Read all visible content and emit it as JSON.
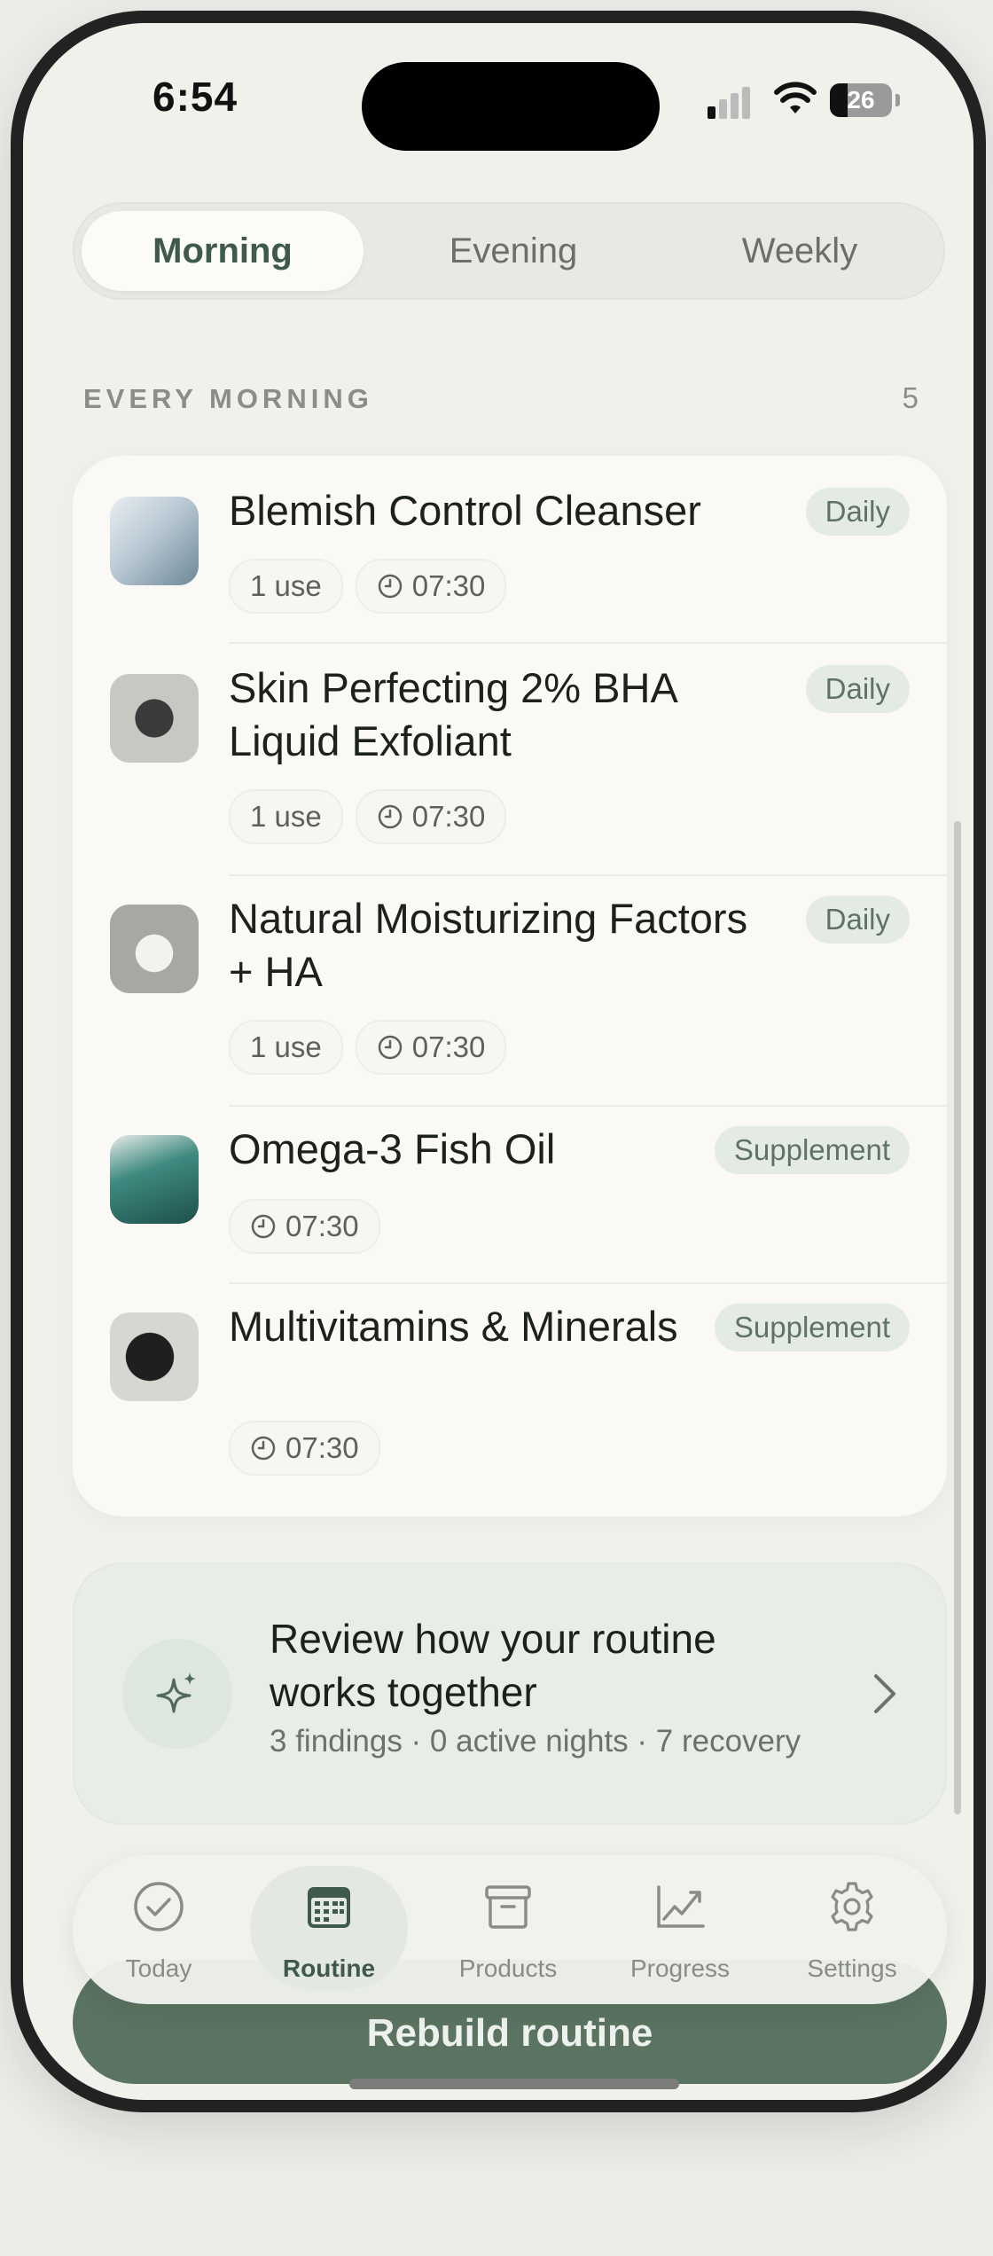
{
  "status_bar": {
    "time": "6:54",
    "battery": "26"
  },
  "tabs": [
    {
      "label": "Morning",
      "active": true
    },
    {
      "label": "Evening",
      "active": false
    },
    {
      "label": "Weekly",
      "active": false
    }
  ],
  "section": {
    "title": "EVERY MORNING",
    "count": "5"
  },
  "items": [
    {
      "name": "Blemish Control Cleanser",
      "tag": "Daily",
      "uses": "1 use",
      "time": "07:30",
      "thumb_color": "#8fa6b5"
    },
    {
      "name": "Skin Perfecting 2% BHA Liquid Exfoliant",
      "tag": "Daily",
      "uses": "1 use",
      "time": "07:30",
      "thumb_color": "#3a3a3a"
    },
    {
      "name": "Natural Moisturizing Factors + HA",
      "tag": "Daily",
      "uses": "1 use",
      "time": "07:30",
      "thumb_color": "#d7d5cf"
    },
    {
      "name": "Omega-3 Fish Oil",
      "tag": "Supplement",
      "time": "07:30",
      "thumb_color": "#2f6f6a"
    },
    {
      "name": "Multivitamins & Minerals",
      "tag": "Supplement",
      "time": "07:30",
      "thumb_color": "#2a2a2a"
    }
  ],
  "review": {
    "title": "Review how your routine works together",
    "subtitle": "3 findings · 0 active nights · 7 recovery"
  },
  "rebuild_button": "Rebuild routine",
  "tabbar": [
    {
      "label": "Today",
      "icon": "check-circle-icon",
      "active": false
    },
    {
      "label": "Routine",
      "icon": "calendar-icon",
      "active": true
    },
    {
      "label": "Products",
      "icon": "archive-box-icon",
      "active": false
    },
    {
      "label": "Progress",
      "icon": "chart-line-icon",
      "active": false
    },
    {
      "label": "Settings",
      "icon": "gear-icon",
      "active": false
    }
  ],
  "colors": {
    "accent": "#3f5a4a",
    "button": "#5b7361",
    "tag_bg": "#e4ebe5"
  }
}
